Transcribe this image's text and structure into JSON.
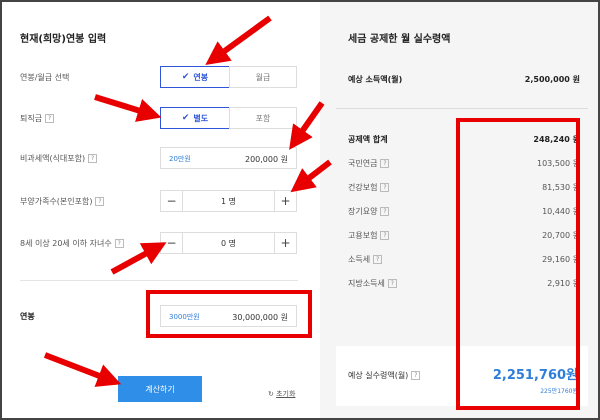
{
  "left": {
    "title": "현재(희망)연봉 입력",
    "salary_type": {
      "label": "연봉/월급 선택",
      "option_annual": "연봉",
      "option_monthly": "월급"
    },
    "severance": {
      "label": "퇴직금",
      "option_separate": "별도",
      "option_included": "포함"
    },
    "nontax": {
      "label": "비과세액(식대포함)",
      "hint": "20만원",
      "value": "200,000",
      "unit": "원"
    },
    "dependents": {
      "label": "부양가족수(본인포함)",
      "value": "1",
      "unit": "명"
    },
    "children": {
      "label": "8세 이상 20세 이하 자녀수",
      "value": "0",
      "unit": "명"
    },
    "salary": {
      "label": "연봉",
      "hint": "3000만원",
      "value": "30,000,000",
      "unit": "원"
    },
    "calculate_label": "계산하기",
    "reset_label": "초기화"
  },
  "right": {
    "title": "세금 공제한 월 실수령액",
    "expected_income_label": "예상 소득액(월)",
    "expected_income_value": "2,500,000 원",
    "deduction_total_label": "공제액 합계",
    "deduction_total_value": "248,240 원",
    "items": [
      {
        "label": "국민연금",
        "value": "103,500 원"
      },
      {
        "label": "건강보험",
        "value": "81,530 원"
      },
      {
        "label": "장기요양",
        "value": "10,440 원"
      },
      {
        "label": "고용보험",
        "value": "20,700 원"
      },
      {
        "label": "소득세",
        "value": "29,160 원"
      },
      {
        "label": "지방소득세",
        "value": "2,910 원"
      }
    ],
    "net_label": "예상 실수령액(월)",
    "net_value": "2,251,760원",
    "net_small": "225만1760원"
  },
  "help_glyph": "?",
  "icons": {
    "check": "check-icon",
    "minus": "minus-icon",
    "plus": "plus-icon",
    "reset": "refresh-icon"
  },
  "colors": {
    "accent": "#2f56d9",
    "button": "#2f8fe8",
    "highlight": "#e80000"
  }
}
